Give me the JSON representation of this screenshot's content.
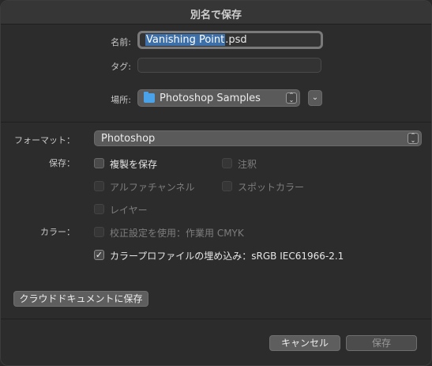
{
  "dialog": {
    "title": "別名で保存"
  },
  "name": {
    "label": "名前:",
    "selected_text": "Vanishing Point",
    "extension": ".psd"
  },
  "tags": {
    "label": "タグ:",
    "value": ""
  },
  "location": {
    "label": "場所:",
    "value": "Photoshop Samples"
  },
  "format": {
    "label": "フォーマット：",
    "value": "Photoshop"
  },
  "save_options": {
    "label": "保存：",
    "items": [
      {
        "label": "複製を保存",
        "checked": false,
        "enabled": true
      },
      {
        "label": "注釈",
        "checked": false,
        "enabled": false
      },
      {
        "label": "アルファチャンネル",
        "checked": false,
        "enabled": false
      },
      {
        "label": "スポットカラー",
        "checked": false,
        "enabled": false
      },
      {
        "label": "レイヤー",
        "checked": false,
        "enabled": false
      }
    ]
  },
  "color_options": {
    "label": "カラー：",
    "items": [
      {
        "label": "校正設定を使用：作業用 CMYK",
        "checked": false,
        "enabled": false
      },
      {
        "label": "カラープロファイルの埋め込み：sRGB IEC61966-2.1",
        "checked": true,
        "enabled": true
      }
    ]
  },
  "cloud_button": "クラウドドキュメントに保存",
  "buttons": {
    "cancel": "キャンセル",
    "save": "保存"
  }
}
